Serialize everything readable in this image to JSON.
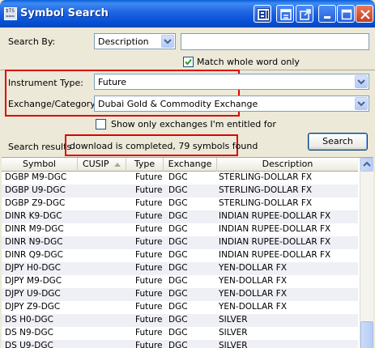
{
  "window": {
    "title": "Symbol Search",
    "icon_text": [
      "$TS",
      "==="
    ]
  },
  "title_buttons": [
    "window-s-icon",
    "window-list-icon",
    "window-popout-icon",
    "minimize-icon",
    "maximize-icon",
    "close-icon"
  ],
  "search": {
    "search_by_label": "Search By:",
    "search_by_value": "Description",
    "search_text_value": "",
    "match_whole_word_label": "Match whole word only",
    "match_whole_word_checked": true,
    "instrument_type_label": "Instrument Type:",
    "instrument_type_value": "Future",
    "exchange_label": "Exchange/Category:",
    "exchange_value": "Dubai Gold & Commodity Exchange",
    "entitled_label": "Show only exchanges I'm entitled for",
    "entitled_checked": false,
    "results_label": "Search results",
    "results_status": "download is completed, 79 symbols found",
    "search_button_label": "Search"
  },
  "highlight_color": "#E00000",
  "table": {
    "columns": [
      "Symbol",
      "CUSIP",
      "Type",
      "Exchange",
      "Description"
    ],
    "sorted_column": "CUSIP",
    "rows": [
      [
        "DGBP M9-DGC",
        "",
        "Future",
        "DGC",
        "STERLING-DOLLAR FX"
      ],
      [
        "DGBP U9-DGC",
        "",
        "Future",
        "DGC",
        "STERLING-DOLLAR FX"
      ],
      [
        "DGBP Z9-DGC",
        "",
        "Future",
        "DGC",
        "STERLING-DOLLAR FX"
      ],
      [
        "DINR K9-DGC",
        "",
        "Future",
        "DGC",
        "INDIAN RUPEE-DOLLAR FX"
      ],
      [
        "DINR M9-DGC",
        "",
        "Future",
        "DGC",
        "INDIAN RUPEE-DOLLAR FX"
      ],
      [
        "DINR N9-DGC",
        "",
        "Future",
        "DGC",
        "INDIAN RUPEE-DOLLAR FX"
      ],
      [
        "DINR Q9-DGC",
        "",
        "Future",
        "DGC",
        "INDIAN RUPEE-DOLLAR FX"
      ],
      [
        "DJPY H0-DGC",
        "",
        "Future",
        "DGC",
        "YEN-DOLLAR FX"
      ],
      [
        "DJPY M9-DGC",
        "",
        "Future",
        "DGC",
        "YEN-DOLLAR FX"
      ],
      [
        "DJPY U9-DGC",
        "",
        "Future",
        "DGC",
        "YEN-DOLLAR FX"
      ],
      [
        "DJPY Z9-DGC",
        "",
        "Future",
        "DGC",
        "YEN-DOLLAR FX"
      ],
      [
        "DS H0-DGC",
        "",
        "Future",
        "DGC",
        "SILVER"
      ],
      [
        "DS N9-DGC",
        "",
        "Future",
        "DGC",
        "SILVER"
      ],
      [
        "DS U9-DGC",
        "",
        "Future",
        "DGC",
        "SILVER"
      ]
    ]
  }
}
